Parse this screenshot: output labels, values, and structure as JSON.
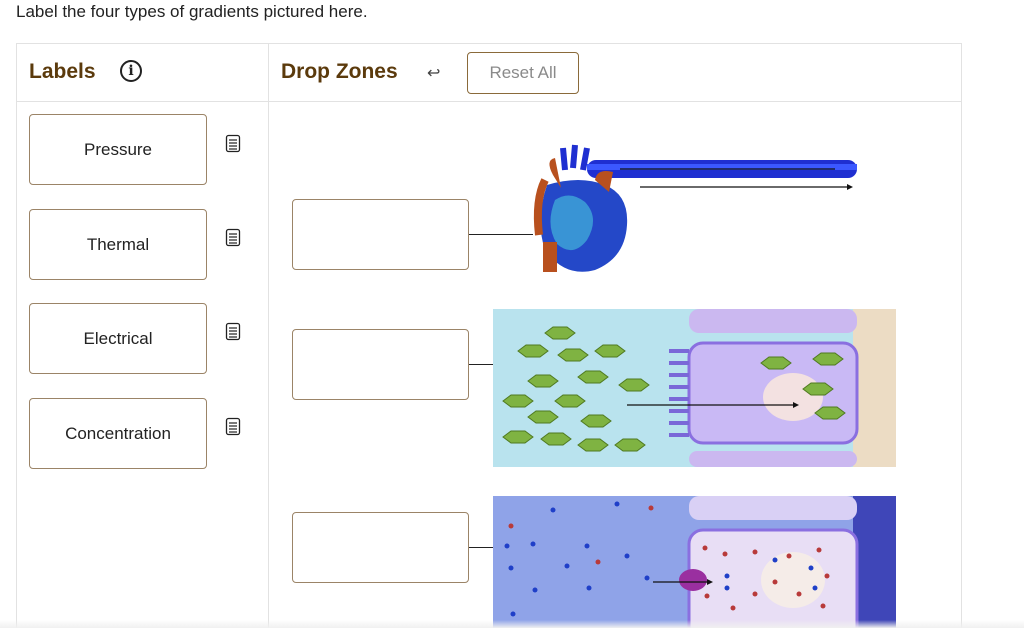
{
  "prompt": "Label the four types of gradients pictured here.",
  "labels_panel": {
    "title": "Labels",
    "info_icon": "info-icon"
  },
  "drop_panel": {
    "title": "Drop Zones",
    "back_icon": "undo-arrow-icon",
    "reset_label": "Reset All"
  },
  "labels": [
    {
      "text": "Pressure",
      "icon": "notes-icon"
    },
    {
      "text": "Thermal",
      "icon": "notes-icon"
    },
    {
      "text": "Electrical",
      "icon": "notes-icon"
    },
    {
      "text": "Concentration",
      "icon": "notes-icon"
    }
  ],
  "drop_zones": [
    {
      "value": "",
      "figure": "heart-blood-vessel-figure"
    },
    {
      "value": "",
      "figure": "cell-concentration-figure"
    },
    {
      "value": "",
      "figure": "cell-electrical-figure"
    }
  ],
  "colors": {
    "heading": "#5b3a0c",
    "card_border": "#9b8467",
    "divider": "#e2e2e2"
  }
}
